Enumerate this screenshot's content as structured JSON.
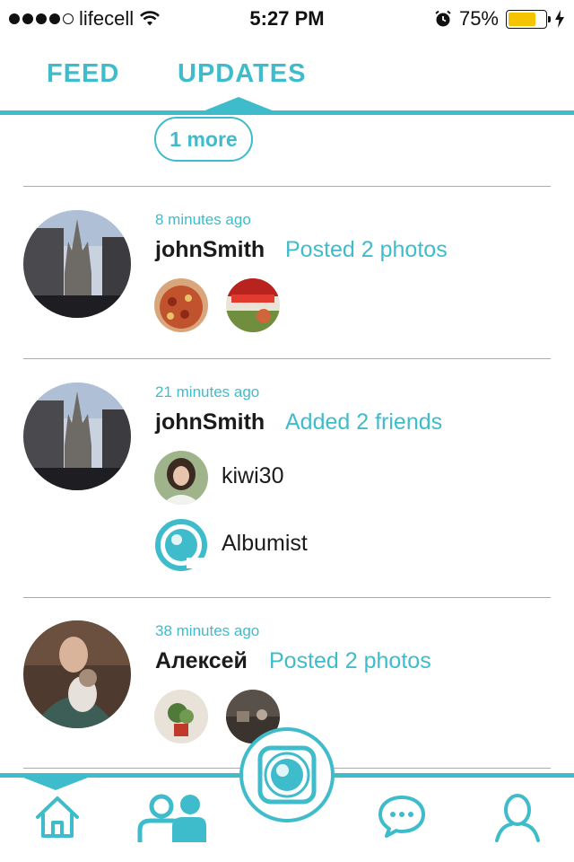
{
  "status_bar": {
    "carrier": "lifecell",
    "time": "5:27 PM",
    "battery": "75%",
    "battery_level": 0.75
  },
  "tabs": [
    {
      "label": "FEED"
    },
    {
      "label": "UPDATES",
      "active": true
    }
  ],
  "more_button": {
    "label": "1 more"
  },
  "updates": [
    {
      "time": "8 minutes ago",
      "user": "johnSmith",
      "action": "Posted 2 photos",
      "photos": [
        "pizza photo",
        "salmon package photo"
      ]
    },
    {
      "time": "21 minutes ago",
      "user": "johnSmith",
      "action": "Added 2 friends",
      "friends": [
        {
          "name": "kiwi30"
        },
        {
          "name": "Albumist"
        }
      ]
    },
    {
      "time": "38 minutes ago",
      "user": "Алексей",
      "action": "Posted 2 photos",
      "photos": [
        "plant photo",
        "room photo"
      ]
    }
  ],
  "bottom_nav": {
    "items": [
      "home-icon",
      "friends-icon",
      "camera-icon",
      "chat-icon",
      "profile-icon"
    ],
    "active": "home-icon"
  },
  "colors": {
    "accent": "#3fbccb",
    "text": "#1b1b1b",
    "battery": "#f5c400"
  }
}
